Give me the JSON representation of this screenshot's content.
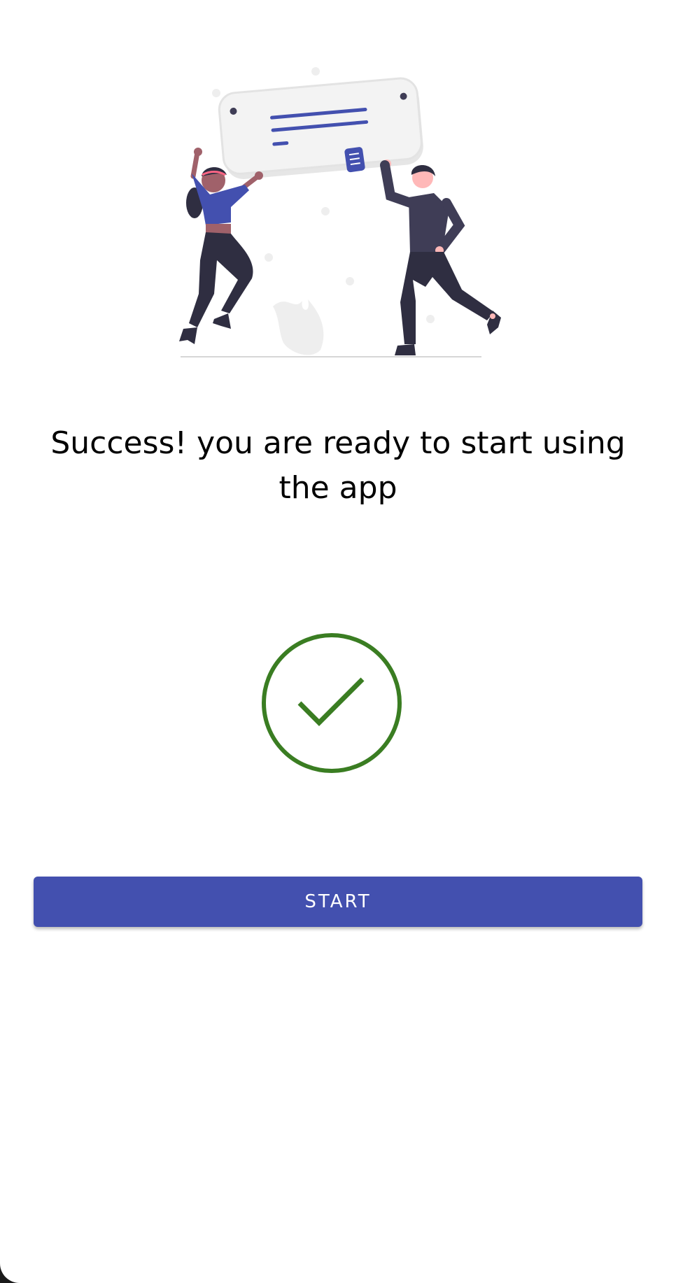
{
  "message": "Success! you are ready to start using the app",
  "start_button_label": "START",
  "illustration": {
    "icon": "celebration-illustration",
    "accent_color": "#4350af",
    "dark_color": "#3f3d56",
    "skin_color": "#a0616a"
  },
  "success_check": {
    "icon": "check-circle-icon",
    "color": "#3a7d22"
  },
  "colors": {
    "primary": "#4350af",
    "background": "#ffffff",
    "text": "#000000"
  }
}
